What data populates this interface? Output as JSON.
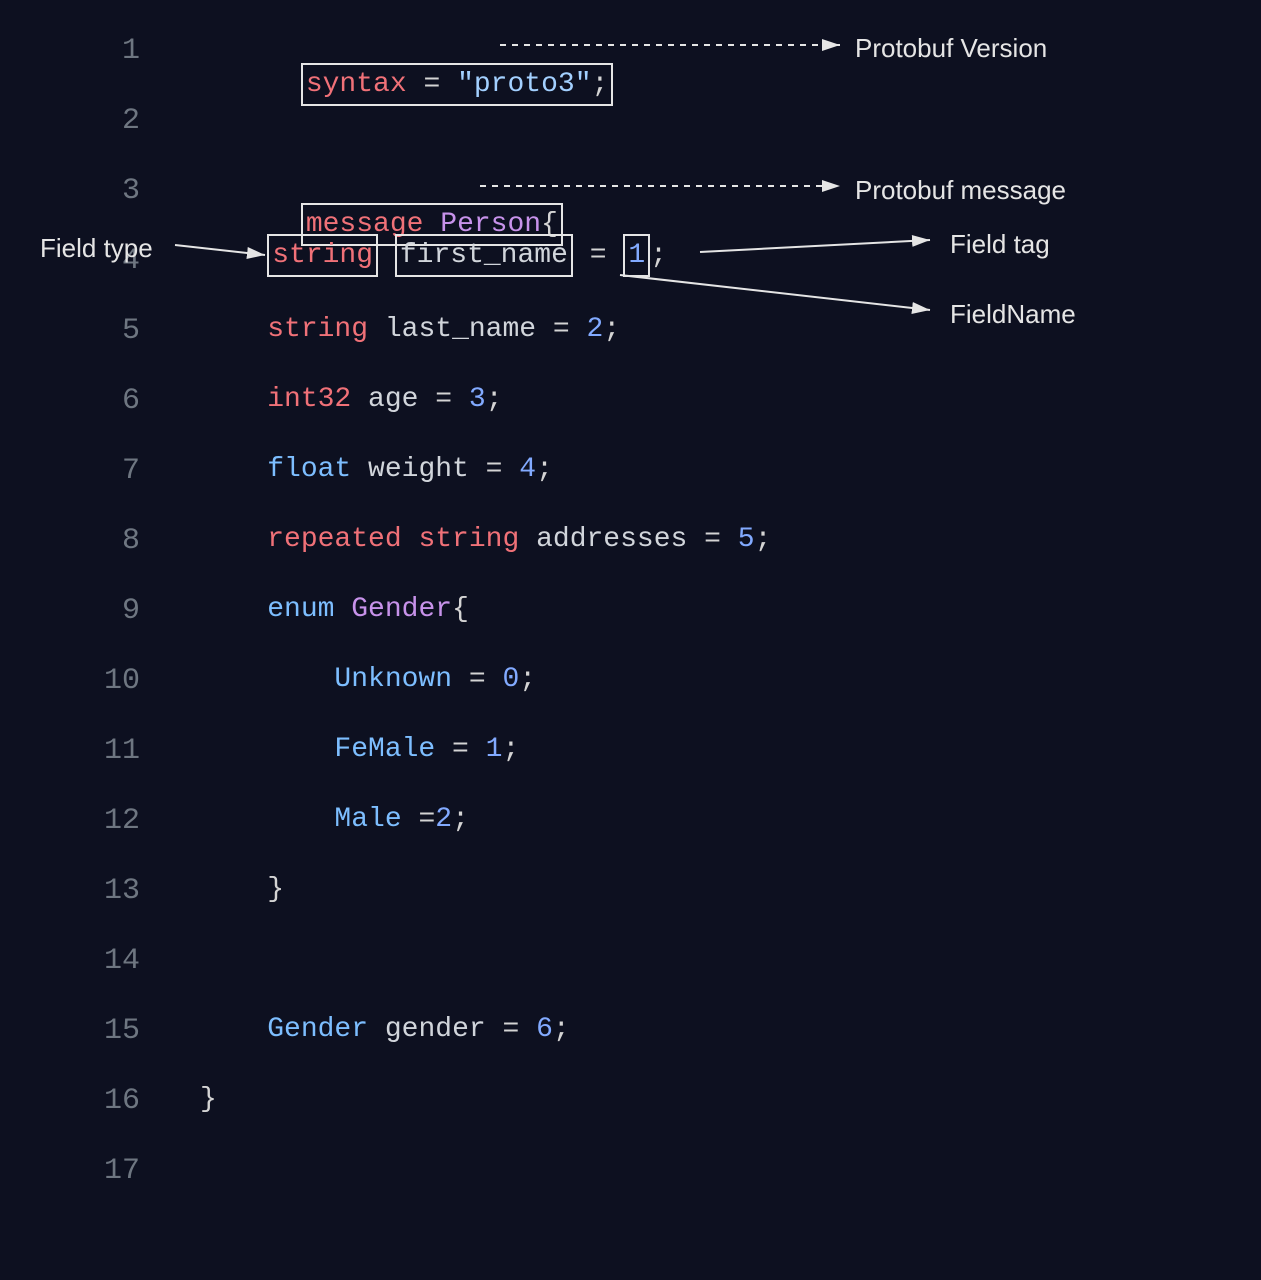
{
  "annotations": {
    "version": "Protobuf Version",
    "message": "Protobuf message",
    "fieldType": "Field type",
    "fieldTag": "Field tag",
    "fieldName": "FieldName"
  },
  "lineNumbers": [
    "1",
    "2",
    "3",
    "4",
    "5",
    "6",
    "7",
    "8",
    "9",
    "10",
    "11",
    "12",
    "13",
    "14",
    "15",
    "16",
    "17"
  ],
  "code": {
    "l1": {
      "kw": "syntax",
      "eq": " = ",
      "str": "\"proto3\"",
      "semi": ";"
    },
    "l3": {
      "kw": "message",
      "sp": " ",
      "name": "Person",
      "brace": "{"
    },
    "l4": {
      "indent": "    ",
      "type": "string",
      "sp": " ",
      "name": "first_name",
      "eq": " = ",
      "num": "1",
      "semi": ";"
    },
    "l5": {
      "indent": "    ",
      "type": "string",
      "sp": " ",
      "name": "last_name",
      "eq": " = ",
      "num": "2",
      "semi": ";"
    },
    "l6": {
      "indent": "    ",
      "type": "int32",
      "sp": " ",
      "name": "age",
      "eq": " = ",
      "num": "3",
      "semi": ";"
    },
    "l7": {
      "indent": "    ",
      "type": "float",
      "sp": " ",
      "name": "weight",
      "eq": " = ",
      "num": "4",
      "semi": ";"
    },
    "l8": {
      "indent": "    ",
      "mod": "repeated",
      "sp1": " ",
      "type": "string",
      "sp2": " ",
      "name": "addresses",
      "eq": " = ",
      "num": "5",
      "semi": ";"
    },
    "l9": {
      "indent": "    ",
      "kw": "enum",
      "sp": " ",
      "name": "Gender",
      "brace": "{"
    },
    "l10": {
      "indent": "        ",
      "name": "Unknown",
      "eq": " = ",
      "num": "0",
      "semi": ";"
    },
    "l11": {
      "indent": "        ",
      "name": "FeMale",
      "eq": " = ",
      "num": "1",
      "semi": ";"
    },
    "l12": {
      "indent": "        ",
      "name": "Male",
      "eq": " =",
      "num": "2",
      "semi": ";"
    },
    "l13": {
      "indent": "    ",
      "brace": "}"
    },
    "l15": {
      "indent": "    ",
      "type": "Gender",
      "sp": " ",
      "name": "gender",
      "eq": " = ",
      "num": "6",
      "semi": ";"
    },
    "l16": {
      "brace": "}"
    }
  }
}
